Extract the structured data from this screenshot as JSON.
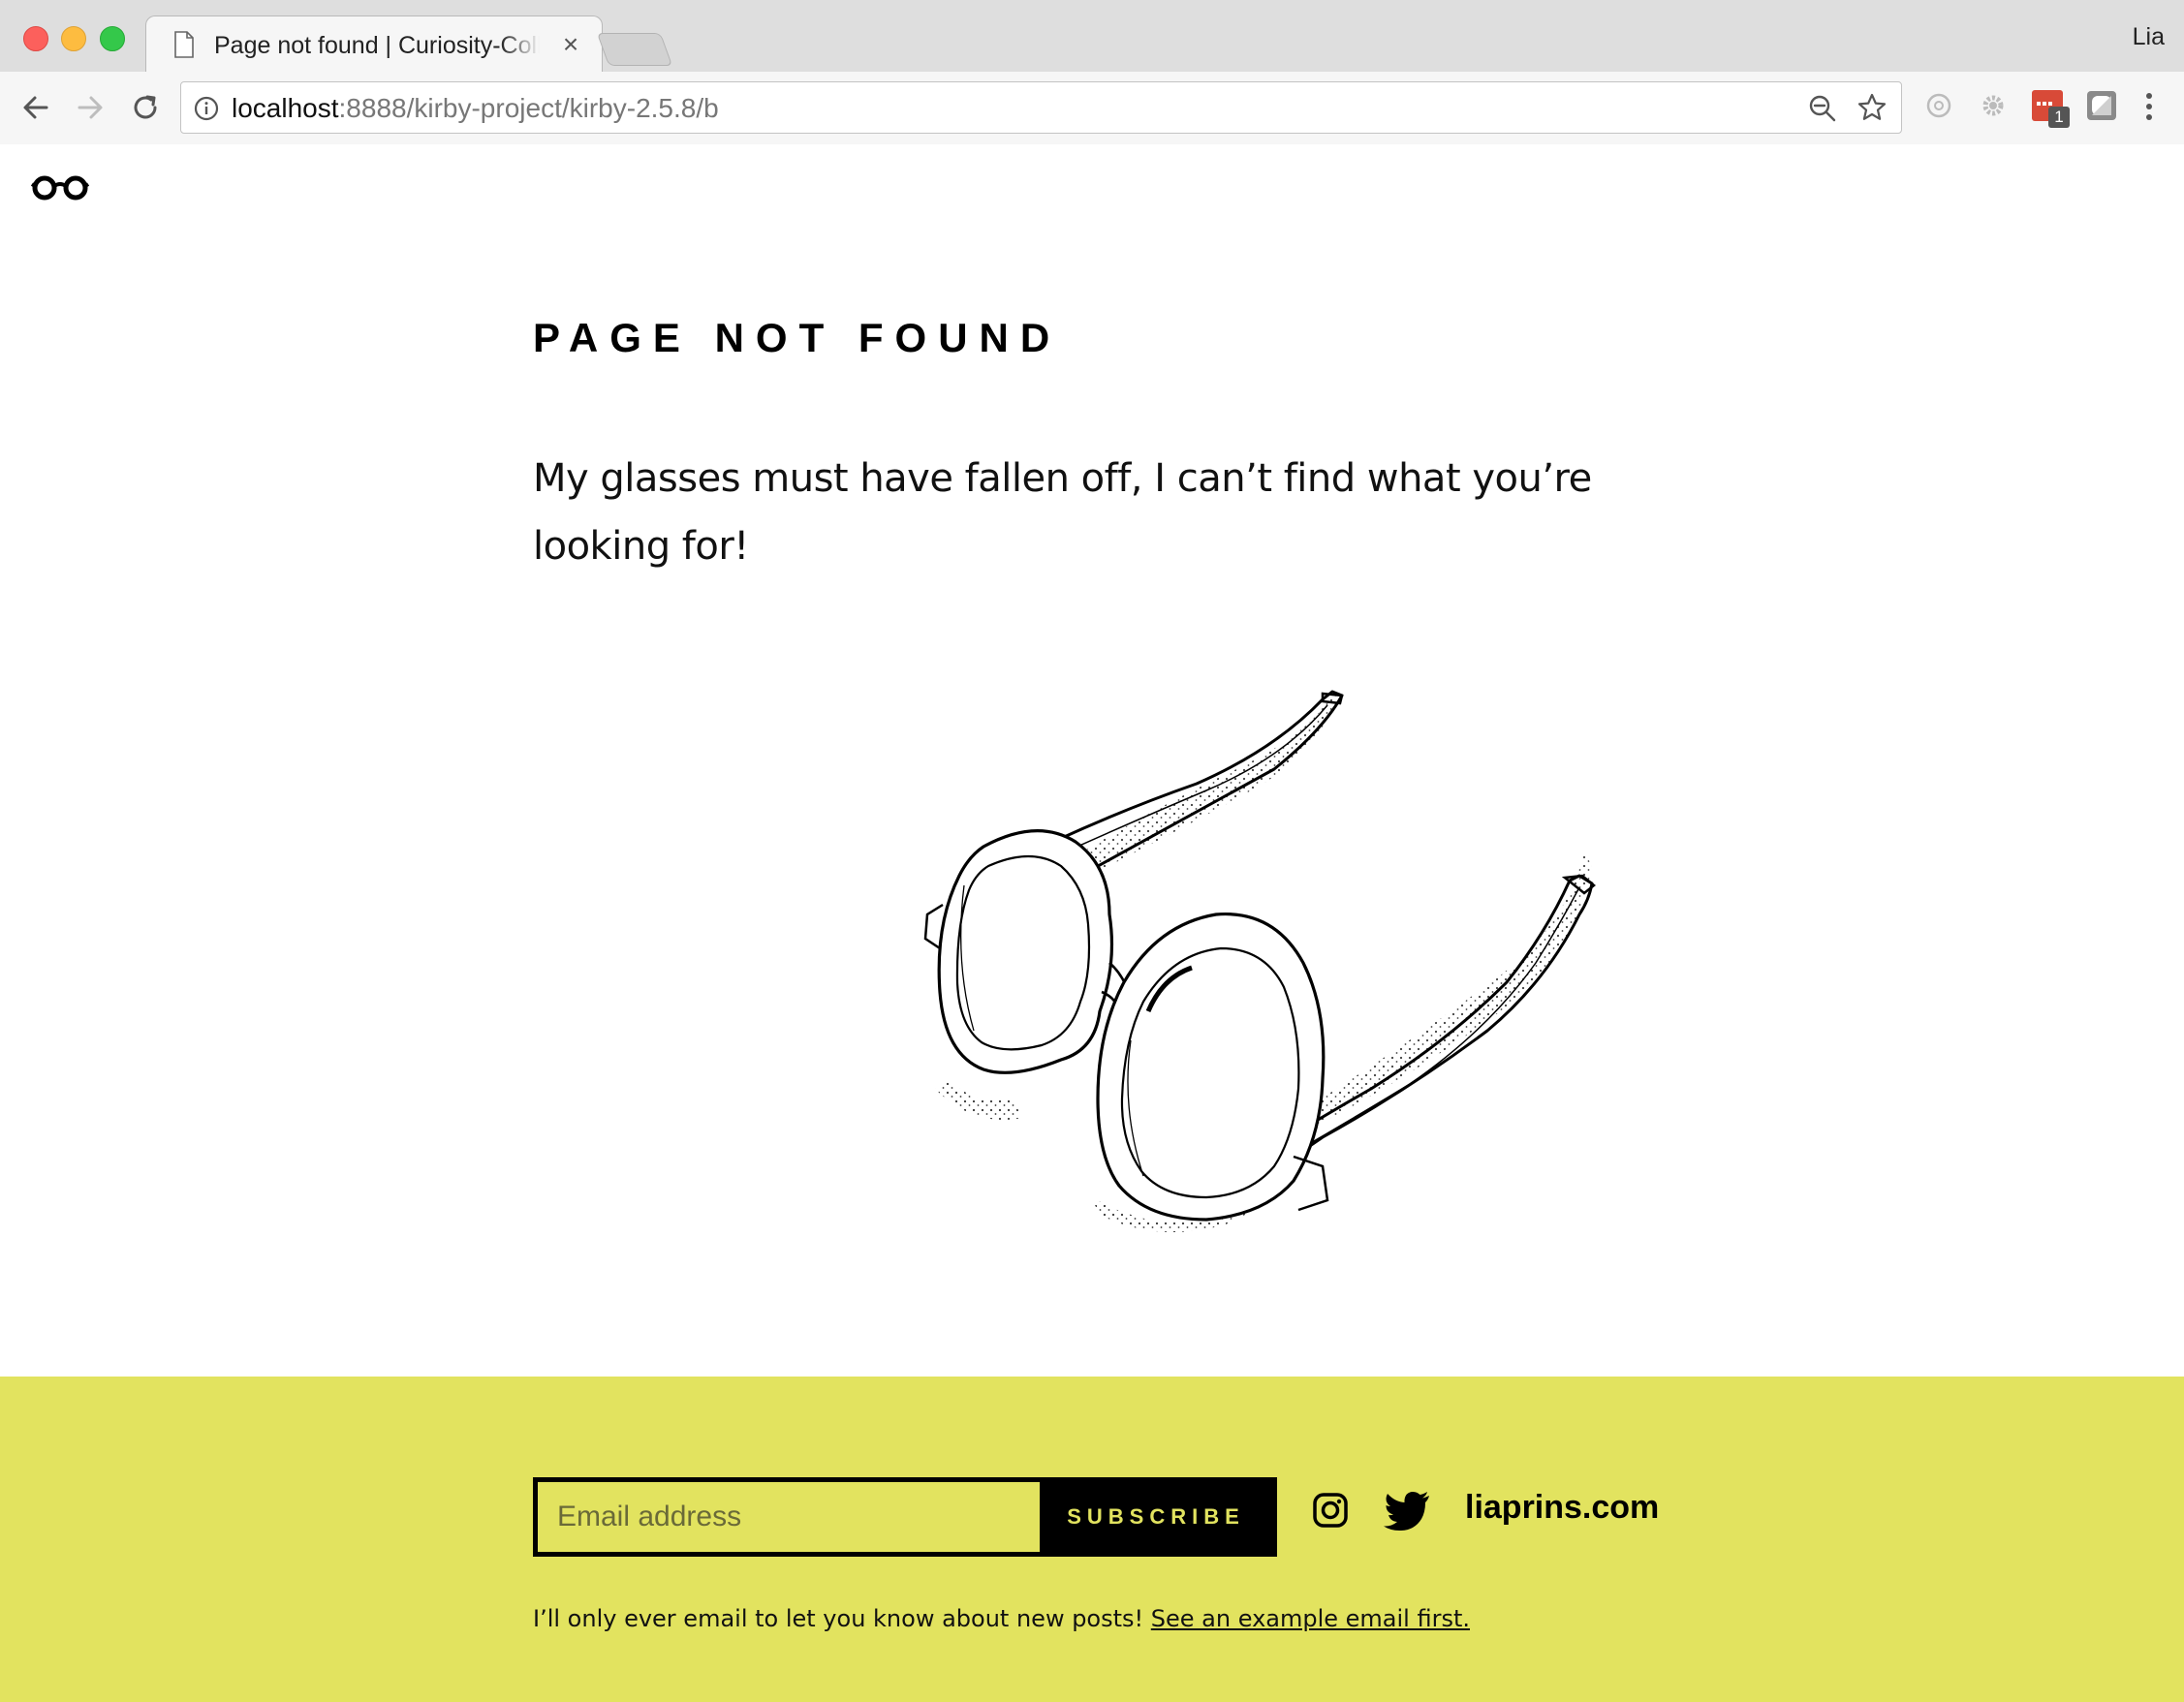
{
  "browser": {
    "tab_title": "Page not found | Curiosity-Collective",
    "tab_close": "×",
    "profile_name": "Lia",
    "url_host": "localhost",
    "url_rest": ":8888/kirby-project/kirby-2.5.8/b",
    "extension_badge": "1"
  },
  "page": {
    "title": "PAGE NOT FOUND",
    "intro": "My glasses must have fallen off, I can’t find what you’re looking for!"
  },
  "footer": {
    "email_placeholder": "Email address",
    "subscribe_label": "SUBSCRIBE",
    "site_link": "liaprins.com",
    "note_text": "I’ll only ever email to let you know about new posts! ",
    "note_link": "See an example email first."
  },
  "colors": {
    "footer_bg": "#e2e35f",
    "text": "#111111"
  },
  "icons": [
    "document-icon",
    "back-icon",
    "forward-icon",
    "reload-icon",
    "info-icon",
    "zoom-icon",
    "star-icon",
    "glasses-logo-icon",
    "instagram-icon",
    "twitter-icon"
  ]
}
